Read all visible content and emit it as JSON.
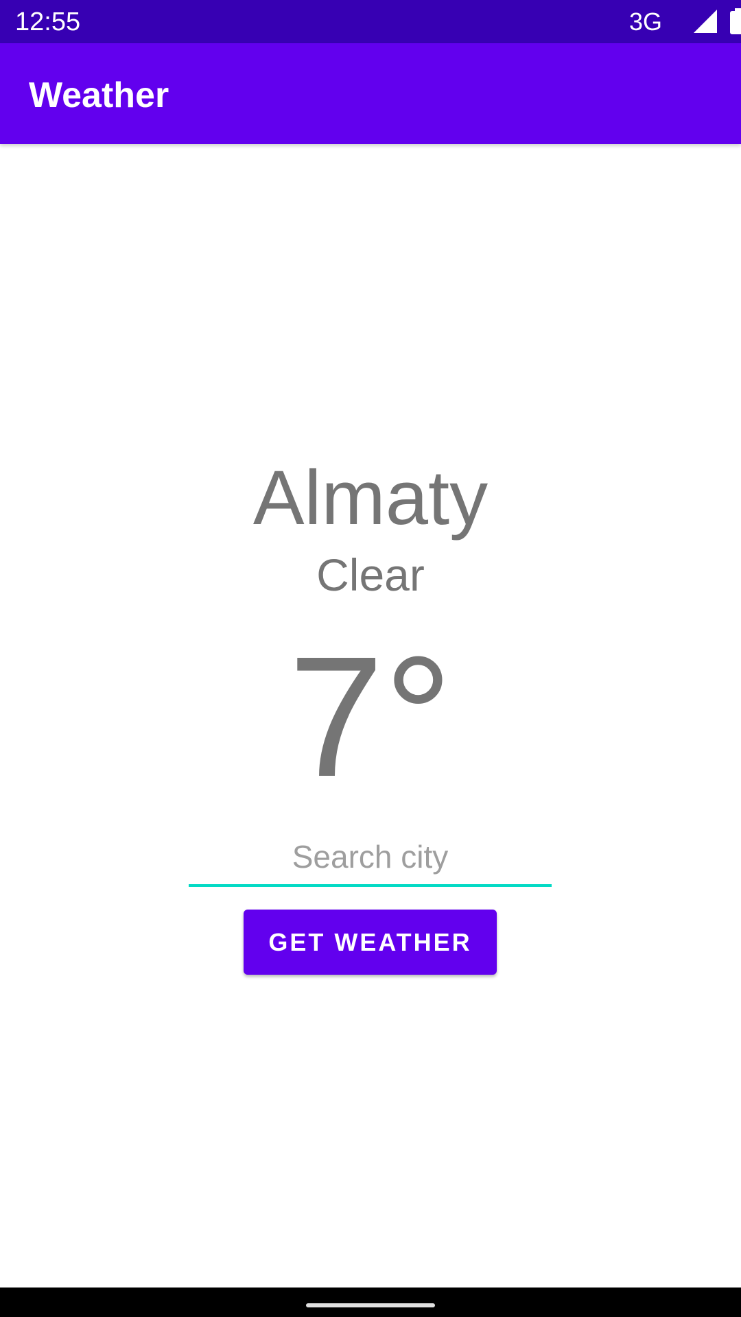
{
  "status_bar": {
    "time": "12:55",
    "network": "3G",
    "signal_icon": "cell-signal-icon",
    "battery_icon": "battery-icon"
  },
  "app_bar": {
    "title": "Weather"
  },
  "weather": {
    "city": "Almaty",
    "condition": "Clear",
    "temperature": "7°"
  },
  "search": {
    "value": "",
    "placeholder": "Search city"
  },
  "actions": {
    "get_weather_label": "GET WEATHER"
  },
  "colors": {
    "status_bar": "#3700B3",
    "primary": "#6200EE",
    "accent": "#03DAC5",
    "text_secondary": "#757575"
  }
}
